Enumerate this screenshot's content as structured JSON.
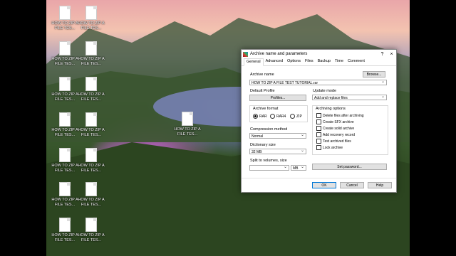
{
  "desktop": {
    "icons": [
      {
        "label": "HOW TO ZIP A FILE TES..."
      },
      {
        "label": "HOW TO ZIP A FILE TES..."
      },
      {
        "label": "HOW TO ZIP A FILE TES..."
      },
      {
        "label": "HOW TO ZIP A FILE TES..."
      },
      {
        "label": "HOW TO ZIP A FILE TES..."
      },
      {
        "label": "HOW TO ZIP A FILE TES..."
      },
      {
        "label": "HOW TO ZIP A FILE TES..."
      },
      {
        "label": "HOW TO ZIP A FILE TES..."
      },
      {
        "label": "HOW TO ZIP A FILE TES..."
      },
      {
        "label": "HOW TO ZIP A FILE TES..."
      },
      {
        "label": "HOW TO ZIP A FILE TES..."
      },
      {
        "label": "HOW TO ZIP A FILE TES..."
      },
      {
        "label": "HOW TO ZIP A FILE TES..."
      },
      {
        "label": "HOW TO ZIP A FILE TES..."
      }
    ],
    "center_icon": {
      "label": "HOW TO ZIP A FILE TES..."
    }
  },
  "dialog": {
    "title": "Archive name and parameters",
    "help": "?",
    "close": "×",
    "tabs": [
      "General",
      "Advanced",
      "Options",
      "Files",
      "Backup",
      "Time",
      "Comment"
    ],
    "archive_name_label": "Archive name",
    "browse": "Browse...",
    "archive_name_value": "HOW TO ZIP A FILE TEST TUTORIAL.rar",
    "default_profile_label": "Default Profile",
    "profiles": "Profiles...",
    "update_mode_label": "Update mode",
    "update_mode_value": "Add and replace files",
    "archive_format_label": "Archive format",
    "formats": [
      "RAR",
      "RAR4",
      "ZIP"
    ],
    "compression_label": "Compression method",
    "compression_value": "Normal",
    "dictionary_label": "Dictionary size",
    "dictionary_value": "32 MB",
    "split_label": "Split to volumes, size",
    "split_value": "",
    "split_unit": "MB",
    "archiving_options_label": "Archiving options",
    "options": [
      "Delete files after archiving",
      "Create SFX archive",
      "Create solid archive",
      "Add recovery record",
      "Test archived files",
      "Lock archive"
    ],
    "set_password": "Set password...",
    "ok": "OK",
    "cancel": "Cancel",
    "help_button": "Help"
  }
}
